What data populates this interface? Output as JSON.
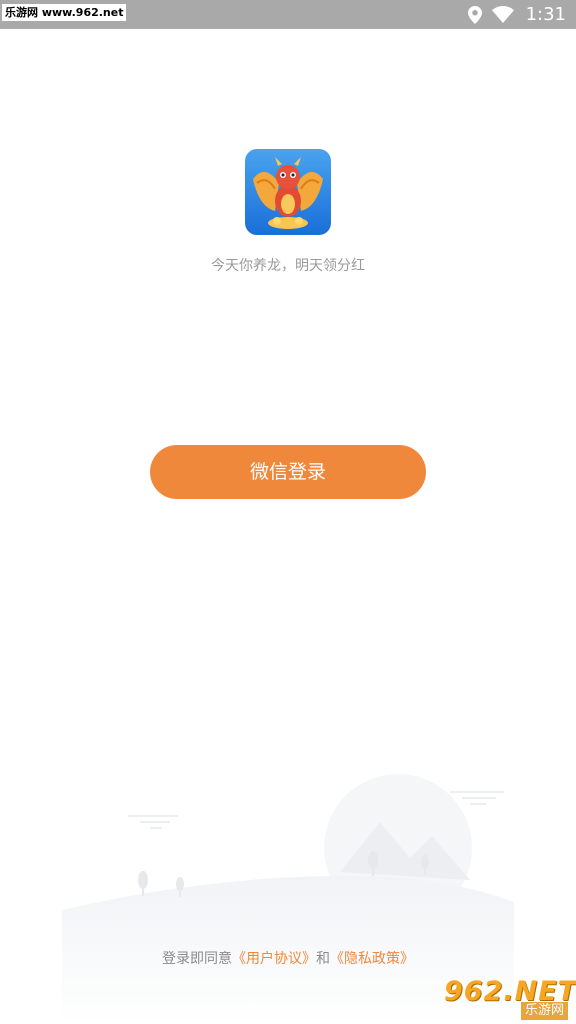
{
  "status_bar": {
    "watermark_text": "乐游网 www.962.net",
    "time": "1:31",
    "icons": [
      "location-icon",
      "wifi-icon"
    ]
  },
  "app": {
    "logo_icon": "dragon-app-logo",
    "tagline": "今天你养龙，明天领分红"
  },
  "login": {
    "wechat_button_label": "微信登录"
  },
  "agreement": {
    "prefix": "登录即同意",
    "user_agreement": "《用户协议》",
    "conjunction": "和",
    "privacy_policy": "《隐私政策》"
  },
  "watermark": {
    "line1": "962.NET",
    "line2": "乐游网"
  },
  "colors": {
    "accent": "#f0883c",
    "status_bar": "#a9a9a9",
    "tagline": "#9a9a9a"
  }
}
